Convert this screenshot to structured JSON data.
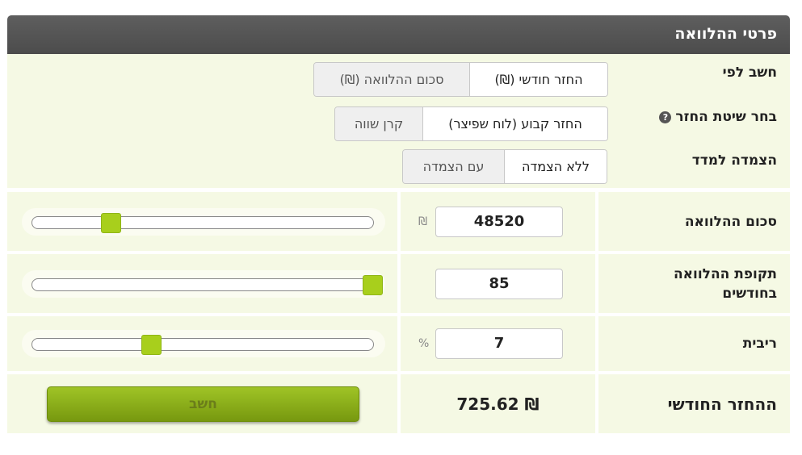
{
  "header": {
    "title": "פרטי ההלוואה"
  },
  "options": {
    "calc_by": {
      "label": "חשב לפי",
      "choices": [
        "החזר חודשי (₪)",
        "סכום ההלוואה (₪)"
      ],
      "selected": "החזר חודשי (₪)"
    },
    "repayment_method": {
      "label": "בחר שיטת החזר",
      "help_icon": "question-circle-icon",
      "choices": [
        "החזר קבוע (לוח שפיצר)",
        "קרן שווה"
      ],
      "selected": "החזר קבוע (לוח שפיצר)"
    },
    "indexation": {
      "label": "הצמדה למדד",
      "choices": [
        "ללא הצמדה",
        "עם הצמדה"
      ],
      "selected": "ללא הצמדה"
    }
  },
  "fields": {
    "loan_amount": {
      "label": "סכום ההלוואה",
      "value": "48520",
      "unit": "₪",
      "slider_fraction": 0.23
    },
    "loan_period": {
      "label_line1": "תקופת ההלוואה",
      "label_line2": "בחודשים",
      "value": "85",
      "unit": "",
      "slider_fraction": 0.995
    },
    "interest": {
      "label": "ריבית",
      "value": "7",
      "unit": "%",
      "slider_fraction": 0.35
    }
  },
  "result": {
    "label": "ההחזר החודשי",
    "value": "725.62 ₪"
  },
  "calculate_button": {
    "label": "חשב"
  },
  "colors": {
    "header_bg": "#555555",
    "panel_bg": "#f5f9e4",
    "accent_green": "#a8cf1c"
  }
}
